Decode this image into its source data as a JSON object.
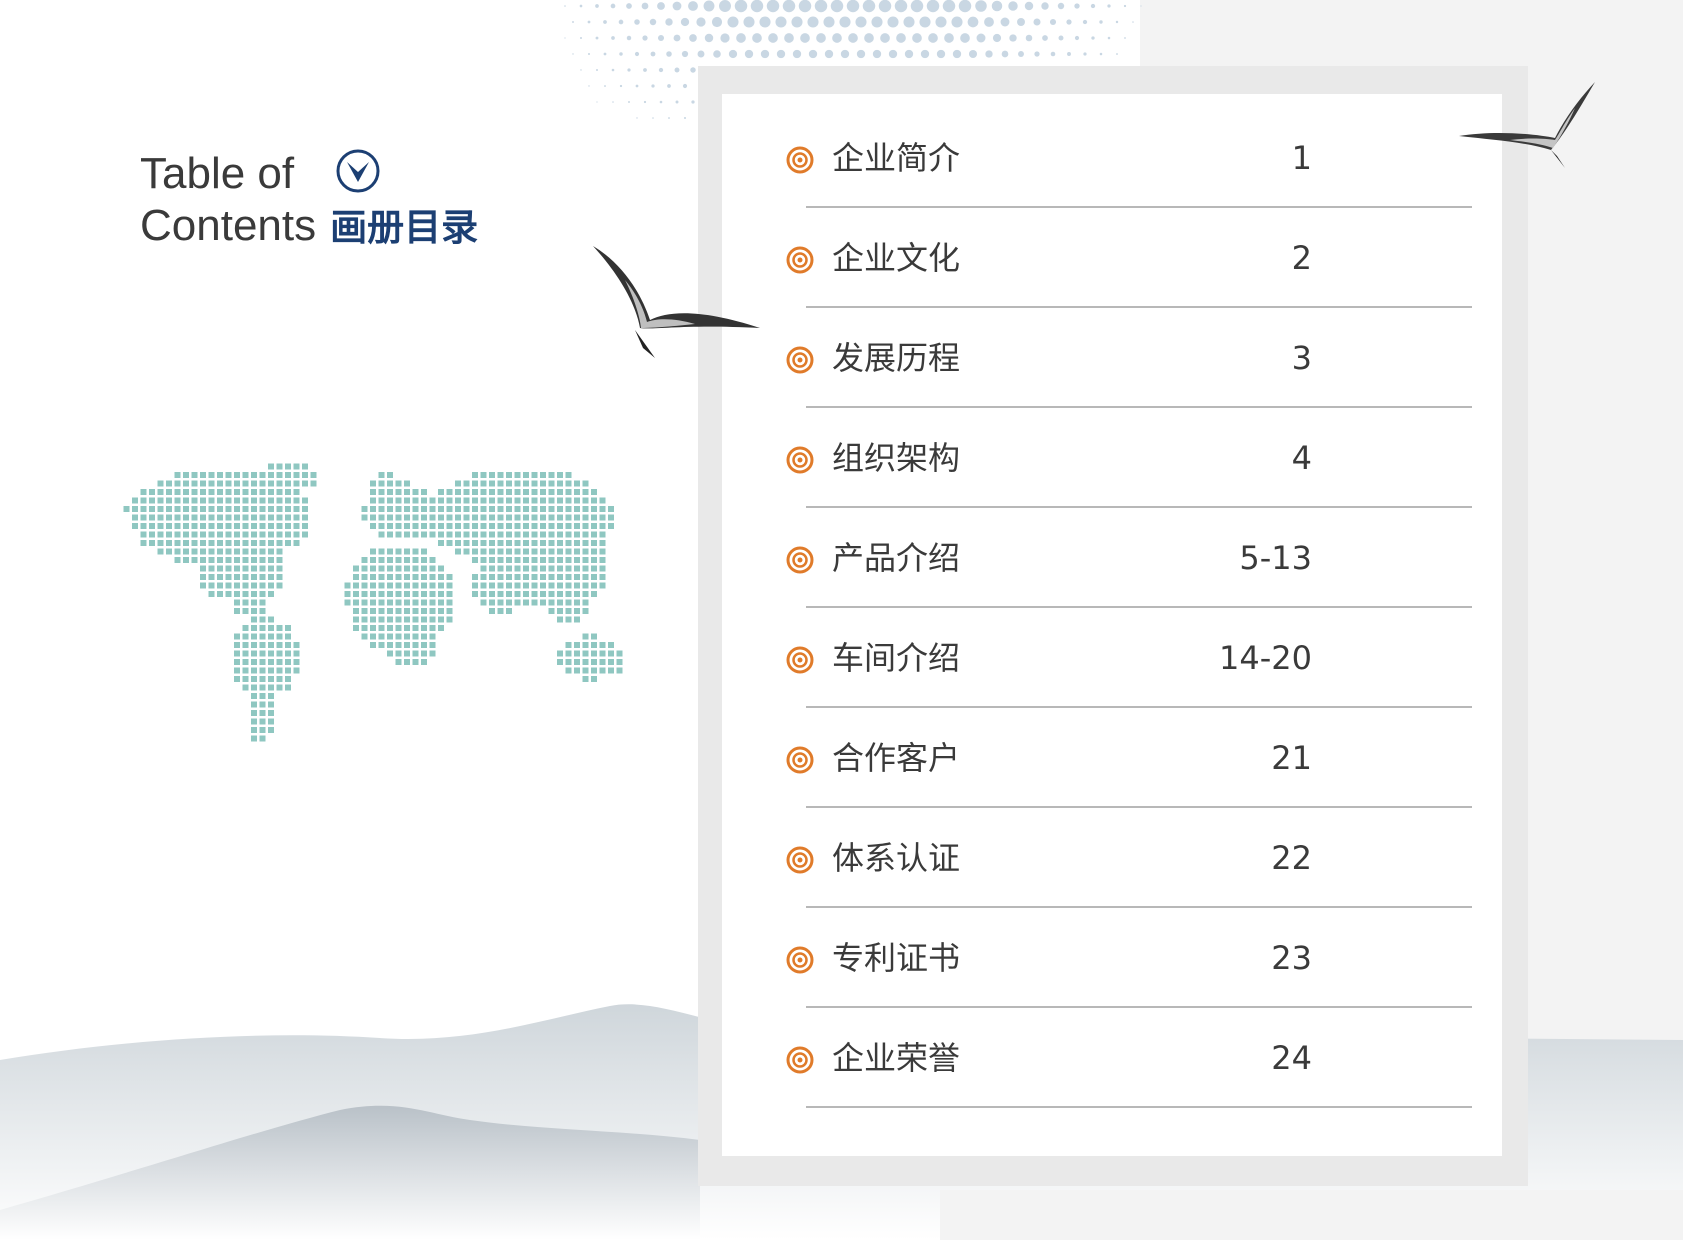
{
  "heading": {
    "line1": "Table of",
    "line2": "Contents",
    "chinese": "画册目录",
    "icon": "chevron-down-circle-icon"
  },
  "colors": {
    "accent": "#e07b2a",
    "heading_blue": "#1c3f73",
    "map_teal": "#8fc7c1",
    "rule": "#b8b8b8"
  },
  "toc": {
    "items": [
      {
        "label": "企业简介",
        "page": "1"
      },
      {
        "label": "企业文化",
        "page": "2"
      },
      {
        "label": "发展历程",
        "page": "3"
      },
      {
        "label": "组织架构",
        "page": "4"
      },
      {
        "label": "产品介绍",
        "page": "5-13"
      },
      {
        "label": "车间介绍",
        "page": "14-20"
      },
      {
        "label": "合作客户",
        "page": "21"
      },
      {
        "label": "体系认证",
        "page": "22"
      },
      {
        "label": "专利证书",
        "page": "23"
      },
      {
        "label": "企业荣誉",
        "page": "24"
      }
    ]
  }
}
